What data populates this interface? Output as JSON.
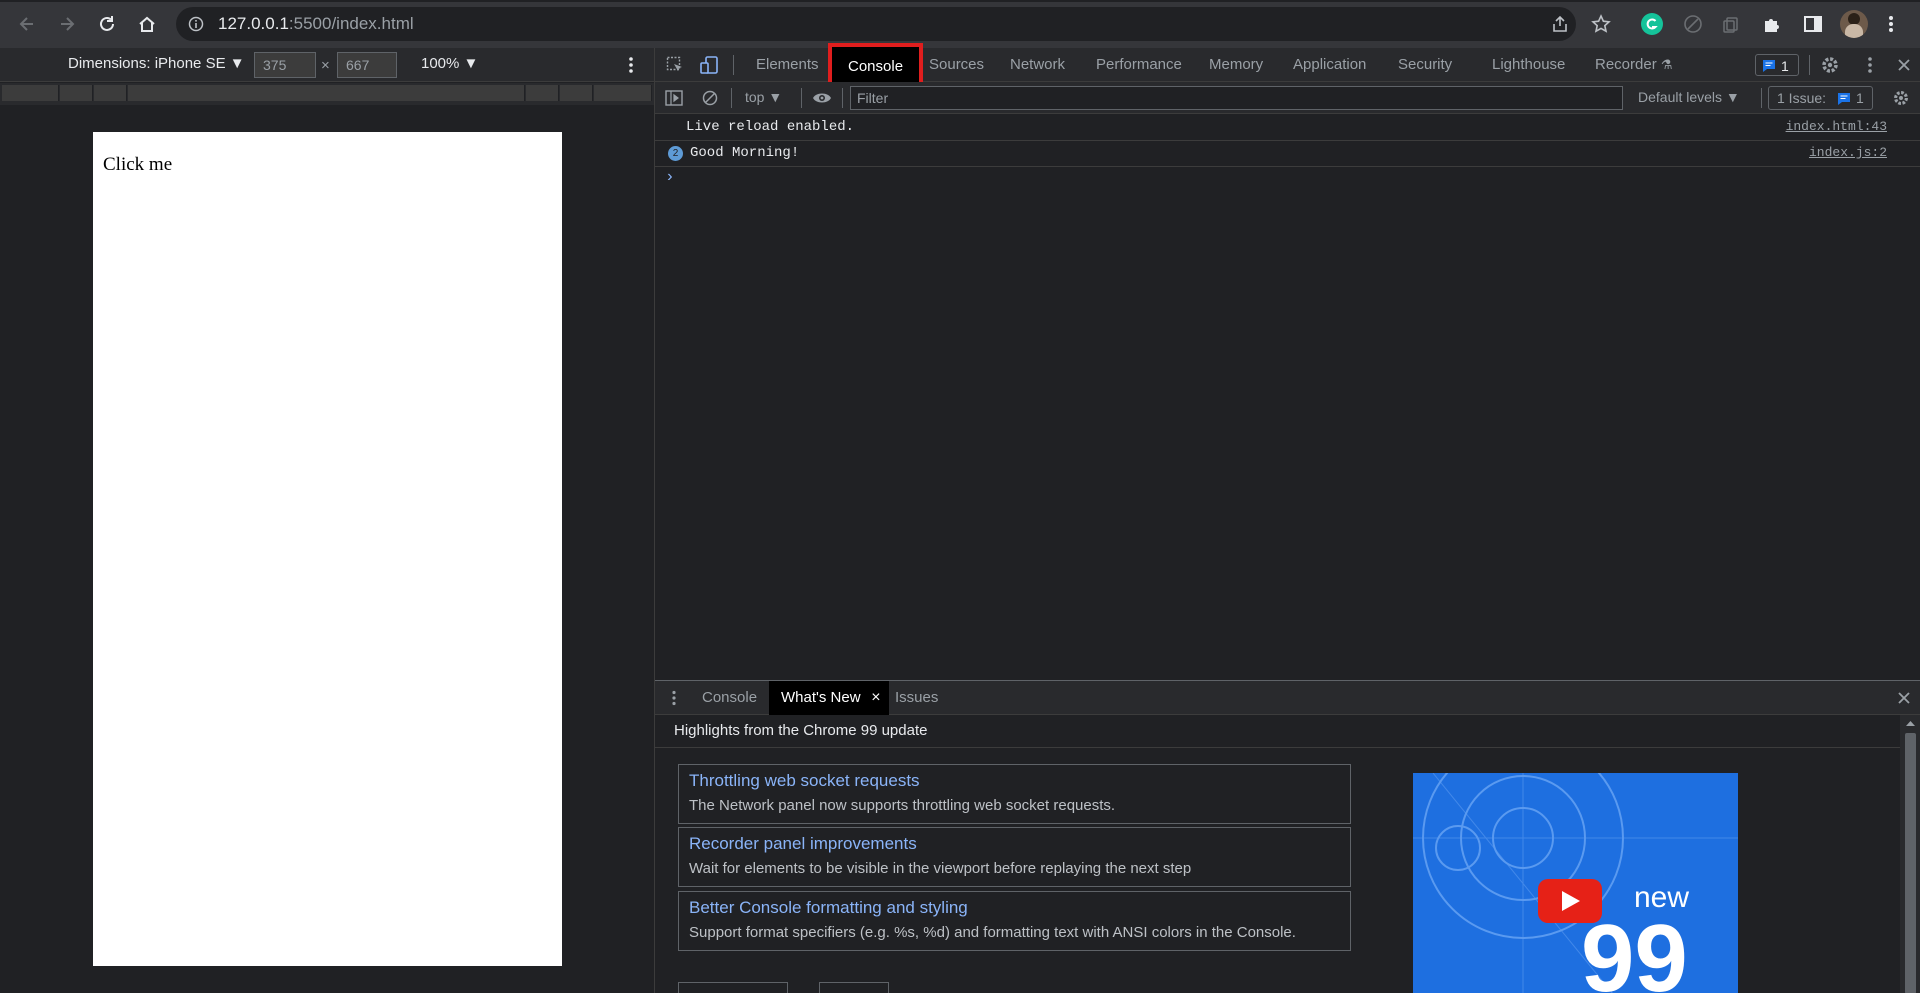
{
  "browser": {
    "url_host": "127.0.0.1",
    "url_rest": ":5500/index.html"
  },
  "device_toolbar": {
    "dimensions_label": "Dimensions: iPhone SE ▼",
    "width": "375",
    "height": "667",
    "times": "×",
    "zoom": "100% ▼"
  },
  "page": {
    "button_text": "Click me"
  },
  "devtools": {
    "tabs": [
      "Elements",
      "Console",
      "Sources",
      "Network",
      "Performance",
      "Memory",
      "Application",
      "Security",
      "Lighthouse",
      "Recorder"
    ],
    "messages_badge": "1",
    "console_toolbar": {
      "context": "top ▼",
      "filter_placeholder": "Filter",
      "levels": "Default levels ▼",
      "issues_label": "1 Issue:",
      "issues_count": "1"
    },
    "messages": [
      {
        "text": "Live reload enabled.",
        "source": "index.html:43"
      },
      {
        "text": "Good Morning!",
        "source": "index.js:2",
        "repeat": "2"
      }
    ],
    "prompt": "›"
  },
  "drawer": {
    "tabs": [
      "Console",
      "What's New",
      "Issues"
    ],
    "close": "×",
    "highlights_title": "Highlights from the Chrome 99 update",
    "cards": [
      {
        "title": "Throttling web socket requests",
        "desc": "The Network panel now supports throttling web socket requests."
      },
      {
        "title": "Recorder panel improvements",
        "desc": "Wait for elements to be visible in the viewport before replaying the next step"
      },
      {
        "title": "Better Console formatting and styling",
        "desc": "Support format specifiers (e.g. %s, %d) and formatting text with ANSI colors in the Console."
      }
    ],
    "video": {
      "new_text": "new",
      "version": "99"
    }
  },
  "colors": {
    "accent_red": "#e01e1e",
    "link_blue": "#8ab4f8",
    "video_blue": "#1e6fe0"
  }
}
